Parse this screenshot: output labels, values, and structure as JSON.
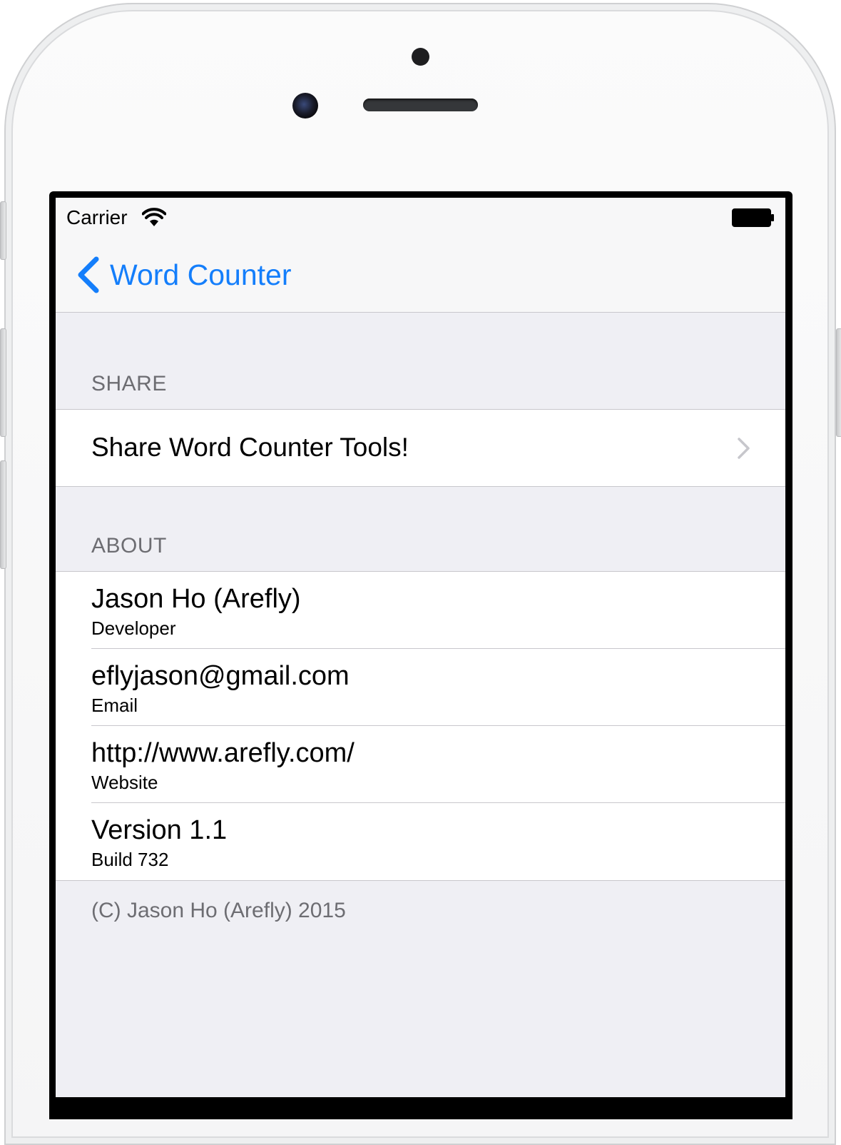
{
  "status_bar": {
    "carrier": "Carrier",
    "wifi_icon": "wifi-icon",
    "battery_icon": "battery-icon"
  },
  "nav": {
    "back_label": "Word Counter",
    "back_icon": "chevron-left-icon"
  },
  "sections": {
    "share": {
      "header": "SHARE",
      "rows": [
        {
          "title": "Share Word Counter Tools!",
          "accessory": "chevron-right-icon"
        }
      ]
    },
    "about": {
      "header": "ABOUT",
      "rows": [
        {
          "title": "Jason Ho (Arefly)",
          "subtitle": "Developer"
        },
        {
          "title": "eflyjason@gmail.com",
          "subtitle": "Email"
        },
        {
          "title": "http://www.arefly.com/",
          "subtitle": "Website"
        },
        {
          "title": "Version 1.1",
          "subtitle": "Build 732"
        }
      ],
      "footer": "(C) Jason Ho (Arefly) 2015"
    }
  },
  "colors": {
    "tint": "#147efb",
    "grouped_background": "#efeff4",
    "section_text": "#6d6d72",
    "separator": "#c8c7cc"
  }
}
